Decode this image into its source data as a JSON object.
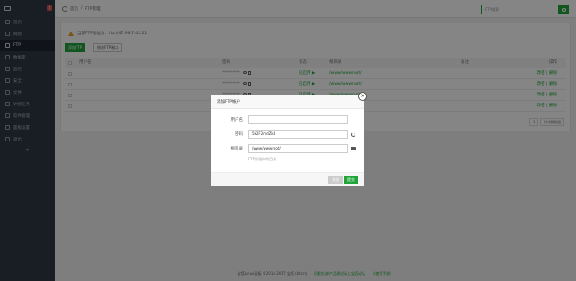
{
  "sidebar": {
    "user": "",
    "badge": "0",
    "items": [
      {
        "label": "首页"
      },
      {
        "label": "网站"
      },
      {
        "label": "FTP",
        "active": true
      },
      {
        "label": "数据库"
      },
      {
        "label": "监控"
      },
      {
        "label": "安全"
      },
      {
        "label": "文件"
      },
      {
        "label": "计划任务"
      },
      {
        "label": "软件管理"
      },
      {
        "label": "面板设置"
      },
      {
        "label": "退出"
      }
    ],
    "add": "+"
  },
  "breadcrumb": {
    "home": "首页",
    "sep": "/",
    "current": "FTP管理"
  },
  "search": {
    "placeholder": "FTP搜索"
  },
  "notice": "当前FTP地址为：ftp://47.99.7.42:21",
  "buttons": {
    "add": "添加FTP",
    "port": "修改FTP端口"
  },
  "table": {
    "headers": {
      "user": "用户名",
      "pass": "密码",
      "status": "状态",
      "path": "根目录",
      "note": "备注",
      "ops": "操作"
    },
    "rows": [
      {
        "user": "",
        "pass": "**********",
        "status": "已启用 ▶",
        "path": "/www/wwwroot/",
        "note": "",
        "ops": "改密 | 删除"
      },
      {
        "user": "",
        "pass": "**********",
        "status": "已启用 ▶",
        "path": "/www/wwwroot/",
        "note": "",
        "ops": "改密 | 删除"
      },
      {
        "user": "",
        "pass": "**********",
        "status": "已启用 ▶",
        "path": "/www/wwwroot/",
        "note": "",
        "ops": "改密 | 删除"
      },
      {
        "user": "",
        "pass": "",
        "status": "",
        "path": "/www",
        "note": "",
        "ops": "改密 | 删除"
      }
    ],
    "pager": {
      "page": "1",
      "total": "共4条数据"
    }
  },
  "footer": {
    "copyright": "宝塔Linux面板 ©2014-2017 宝塔 (bt.cn)",
    "link1": "问题交流/产品建议请上宝塔论坛",
    "link2": "《使用手册》"
  },
  "modal": {
    "title": "添加FTP帐户",
    "close": "×",
    "fields": {
      "user_label": "用户名",
      "user_value": "",
      "pass_label": "密码",
      "pass_value": "5k2F2mdZk8",
      "path_label": "根目录",
      "path_value": "/www/wwwroot/"
    },
    "hint": "FTP所指向的目录",
    "cancel": "关闭",
    "ok": "提交"
  },
  "colors": {
    "accent": "#20a53a",
    "sidebar": "#313b48",
    "warning": "#e8a224"
  }
}
